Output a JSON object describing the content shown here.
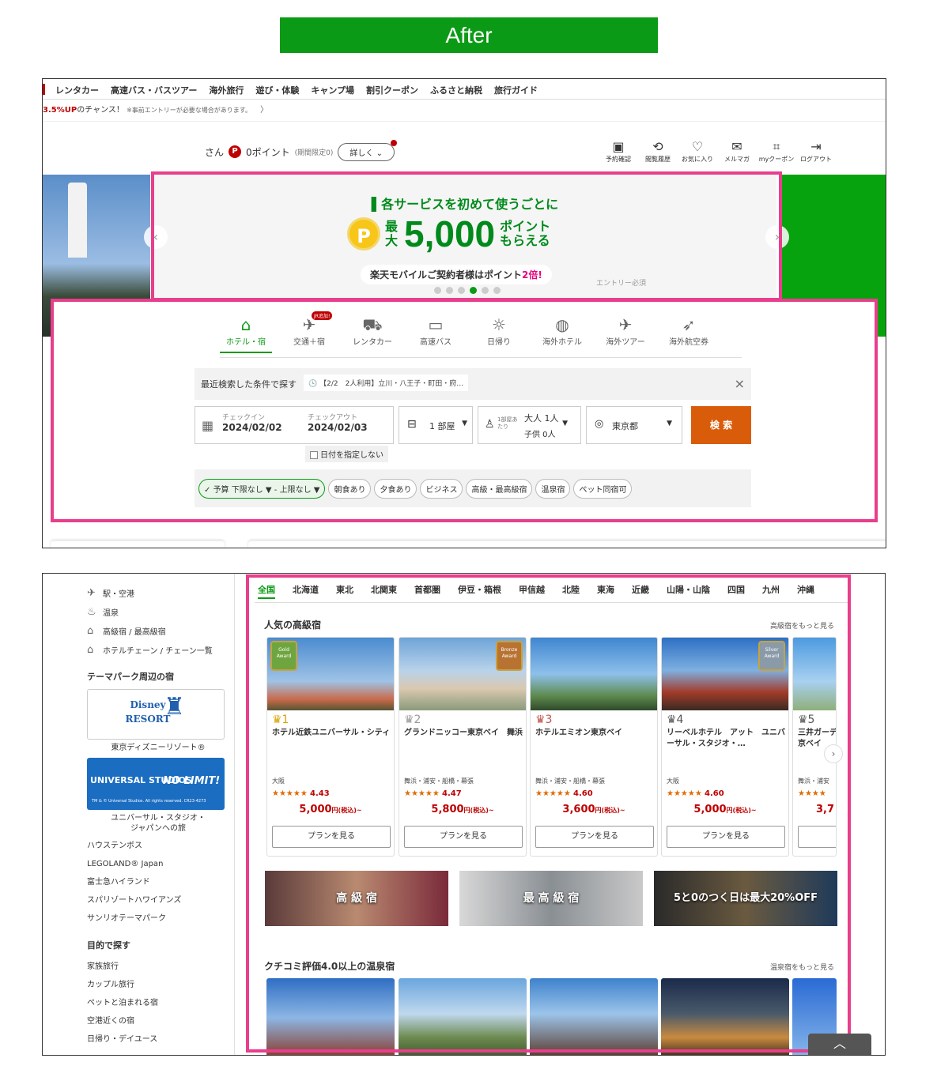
{
  "heading": "After",
  "shot1": {
    "topnav": [
      "レンタカー",
      "高速バス・バスツアー",
      "海外旅行",
      "遊び・体験",
      "キャンプ場",
      "割引クーポン",
      "ふるさと納税",
      "旅行ガイド"
    ],
    "promo": {
      "red": "3.5%UP",
      "text": "のチャンス！",
      "note": "※事前エントリーが必要な場合があります。",
      "arrow": "〉"
    },
    "user": {
      "suffix": "さん",
      "p": "P",
      "points": "0ポイント",
      "limited": "(期間限定0)",
      "detail": "詳しく"
    },
    "icons": [
      {
        "name": "reservation-icon",
        "glyph": "▣",
        "label": "予約確認"
      },
      {
        "name": "history-icon",
        "glyph": "⟲",
        "label": "閲覧履歴"
      },
      {
        "name": "heart-icon",
        "glyph": "♡",
        "label": "お気に入り"
      },
      {
        "name": "mail-icon",
        "glyph": "✉",
        "label": "メルマガ"
      },
      {
        "name": "coupon-icon",
        "glyph": "⌗",
        "label": "myクーポン"
      },
      {
        "name": "logout-icon",
        "glyph": "⇥",
        "label": "ログアウト"
      }
    ],
    "hero": {
      "headline": "各サービスを初めて使うごとに",
      "coin": "P",
      "pre": "最大",
      "amount": "5,000",
      "post1": "ポイント",
      "post2": "もらえる",
      "mobile_a": "楽天モバイルご契約者様はポイント",
      "mobile_b": "2倍!",
      "entry": "エントリー必須",
      "prev": "‹",
      "next": "›"
    },
    "tabs": [
      {
        "glyph": "⌂",
        "label": "ホテル・宿"
      },
      {
        "glyph": "✈",
        "label": "交通＋宿",
        "badge": "JR追加!"
      },
      {
        "glyph": "⛟",
        "label": "レンタカー"
      },
      {
        "glyph": "▭",
        "label": "高速バス"
      },
      {
        "glyph": "☼",
        "label": "日帰り"
      },
      {
        "glyph": "◍",
        "label": "海外ホテル"
      },
      {
        "glyph": "✈",
        "label": "海外ツアー"
      },
      {
        "glyph": "➶",
        "label": "海外航空券"
      }
    ],
    "recent": {
      "label": "最近検索した条件で探す",
      "value": "【2/2　2人利用】立川・八王子・町田・府…",
      "close": "×"
    },
    "checkin": {
      "label": "チェックイン",
      "value": "2024/02/02"
    },
    "checkout": {
      "label": "チェックアウト",
      "value": "2024/02/03"
    },
    "nodate": "日付を指定しない",
    "rooms": "1 部屋",
    "guests": {
      "per": "1部屋あたり",
      "adults": "大人 1人",
      "children": "子供 0人"
    },
    "area": "東京都",
    "search": "検 索",
    "filters": [
      "予算 下限なし ▼ - 上限なし ▼",
      "朝食あり",
      "夕食あり",
      "ビジネス",
      "高級・最高級宿",
      "温泉宿",
      "ペット同宿可"
    ]
  },
  "shot2": {
    "sidebar": {
      "rows": [
        {
          "glyph": "✈",
          "label": "駅・空港"
        },
        {
          "glyph": "♨",
          "label": "温泉"
        },
        {
          "glyph": "⌂",
          "label": "高級宿 / 最高級宿"
        },
        {
          "glyph": "⌂",
          "label": "ホテルチェーン / チェーン一覧"
        }
      ],
      "theme_title": "テーマパーク周辺の宿",
      "tdl_logo": "Disney RESORT",
      "tdl_caption": "東京ディズニーリゾート®",
      "usj_a": "UNIVERSAL STUDIOS",
      "usj_b": "NO LIMIT!",
      "usj_c": "TM & © Universal Studios. All rights reserved. CR23-4273",
      "usj_caption": "ユニバーサル・スタジオ・ジャパンへの旅",
      "parks": [
        "ハウステンボス",
        "LEGOLAND® Japan",
        "富士急ハイランド",
        "スパリゾートハワイアンズ",
        "サンリオテーマパーク"
      ],
      "purpose_title": "目的で探す",
      "purposes": [
        "家族旅行",
        "カップル旅行",
        "ペットと泊まれる宿",
        "空港近くの宿",
        "日帰り・デイユース"
      ]
    },
    "regions": [
      "全国",
      "北海道",
      "東北",
      "北関東",
      "首都圏",
      "伊豆・箱根",
      "甲信越",
      "北陸",
      "東海",
      "近畿",
      "山陽・山陰",
      "四国",
      "九州",
      "沖縄"
    ],
    "luxury_title": "人気の高級宿",
    "luxury_more": "高級宿をもっと見る",
    "cards": [
      {
        "rank": "♛1",
        "award": "Gold Award",
        "name": "ホテル近鉄ユニバーサル・シティ",
        "area": "大阪",
        "stars": "★★★★★",
        "score": "4.43",
        "price": "5,000",
        "unit": "円(税込)~",
        "plan": "プランを見る"
      },
      {
        "rank": "♛2",
        "award": "Bronze Award",
        "name": "グランドニッコー東京ベイ　舞浜",
        "area": "舞浜・浦安・船橋・幕張",
        "stars": "★★★★★",
        "score": "4.47",
        "price": "5,800",
        "unit": "円(税込)~",
        "plan": "プランを見る"
      },
      {
        "rank": "♛3",
        "award": "",
        "name": "ホテルエミオン東京ベイ",
        "area": "舞浜・浦安・船橋・幕張",
        "stars": "★★★★★",
        "score": "4.60",
        "price": "3,600",
        "unit": "円(税込)~",
        "plan": "プランを見る"
      },
      {
        "rank": "♛4",
        "award": "Silver Award",
        "name": "リーベルホテル　アット　ユニバーサル・スタジオ・…",
        "area": "大阪",
        "stars": "★★★★★",
        "score": "4.60",
        "price": "5,000",
        "unit": "円(税込)~",
        "plan": "プランを見る"
      },
      {
        "rank": "♛5",
        "award": "",
        "name": "三井ガーデ京ベイ",
        "area": "舞浜・浦安",
        "stars": "★★★★",
        "score": "",
        "price": "3,7",
        "unit": "",
        "plan": "プ"
      }
    ],
    "banners": [
      "高 級 宿",
      "最 高 級 宿",
      "5と0のつく日は最大20%OFF"
    ],
    "onsen_title": "クチコミ評価4.0以上の温泉宿",
    "onsen_more": "温泉宿をもっと見る",
    "next": "›",
    "totop": "︿"
  }
}
